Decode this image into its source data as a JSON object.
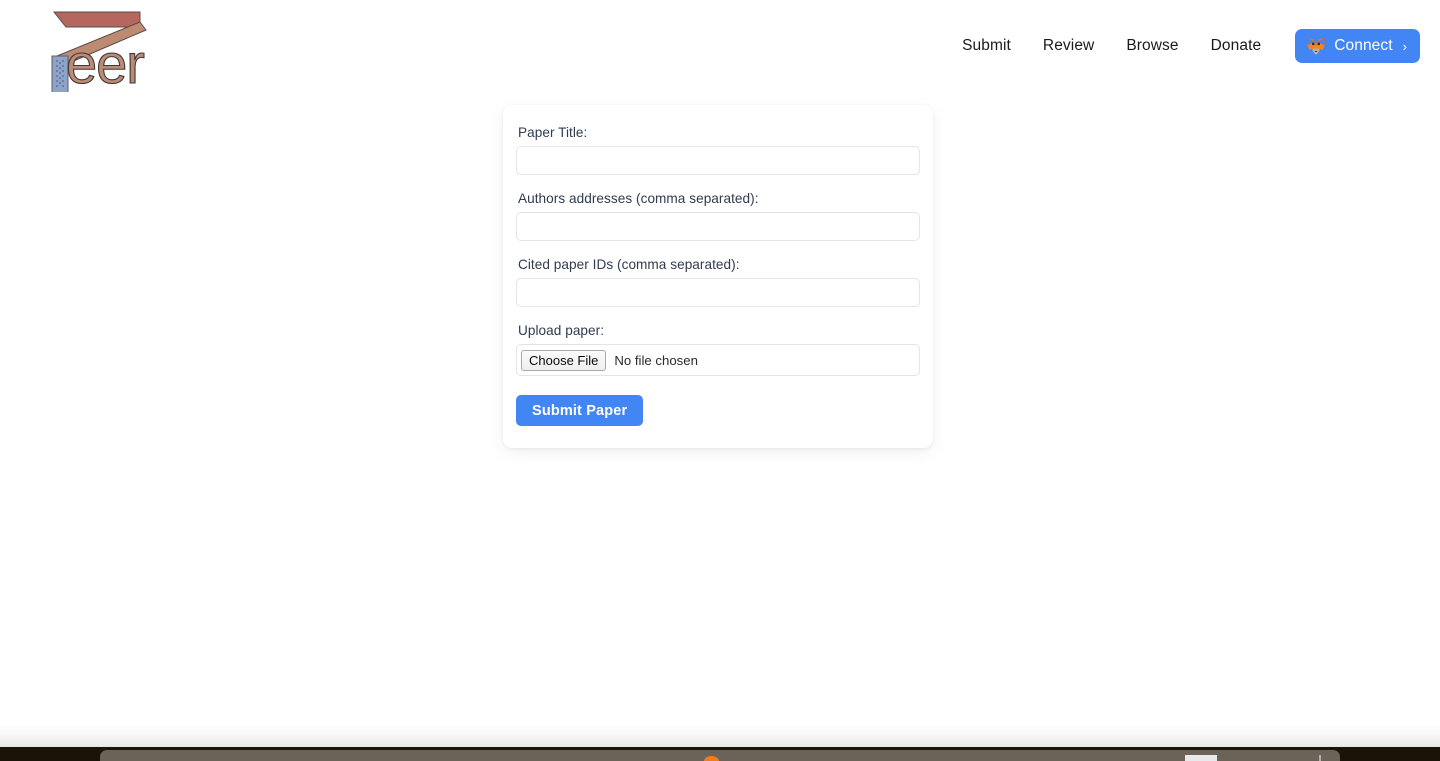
{
  "brand": {
    "name": "Peer",
    "logo_icon": "peer-logo",
    "colors": {
      "bar_red": "#b5675f",
      "bar_tan": "#bd8a72",
      "bar_blue": "#8fa4c4",
      "wordmark": "#bd8a72"
    }
  },
  "nav": {
    "links": [
      {
        "label": "Submit",
        "name": "nav-link-submit"
      },
      {
        "label": "Review",
        "name": "nav-link-review"
      },
      {
        "label": "Browse",
        "name": "nav-link-browse"
      },
      {
        "label": "Donate",
        "name": "nav-link-donate"
      }
    ],
    "connect": {
      "label": "Connect",
      "icon": "metamask-fox-icon",
      "chevron": "›",
      "color": "#4285f4"
    }
  },
  "form": {
    "fields": {
      "title": {
        "label": "Paper Title:",
        "value": "",
        "placeholder": ""
      },
      "authors": {
        "label": "Authors addresses (comma separated):",
        "value": "",
        "placeholder": ""
      },
      "citations": {
        "label": "Cited paper IDs (comma separated):",
        "value": "",
        "placeholder": ""
      },
      "upload": {
        "label": "Upload paper:",
        "button_label": "Choose File",
        "status": "No file chosen"
      }
    },
    "submit": {
      "label": "Submit Paper",
      "color": "#4285f4"
    }
  },
  "taskbar": {
    "visible": true,
    "background": "#1b1208",
    "dock_color": "#6b6358",
    "firefox_icon": "firefox-icon"
  }
}
